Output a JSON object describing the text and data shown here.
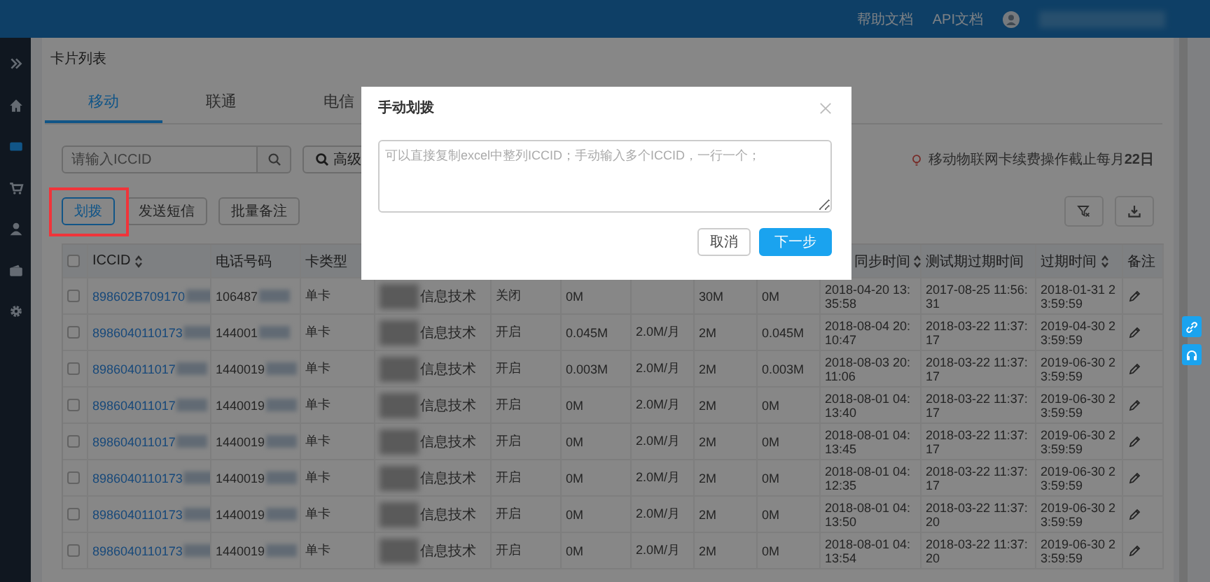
{
  "top_bar": {
    "links": [
      "帮助文档",
      "API文档"
    ]
  },
  "sidebar": {
    "items": [
      {
        "kind": "expand",
        "selected": false
      },
      {
        "kind": "home",
        "selected": false
      },
      {
        "kind": "card",
        "selected": true
      },
      {
        "kind": "cart",
        "selected": false
      },
      {
        "kind": "user",
        "selected": false
      },
      {
        "kind": "wallet",
        "selected": false
      },
      {
        "kind": "settings",
        "selected": false
      }
    ]
  },
  "page_title": "卡片列表",
  "tabs": [
    {
      "label": "移动",
      "selected": true
    },
    {
      "label": "联通",
      "selected": false
    },
    {
      "label": "电信",
      "selected": false
    }
  ],
  "search": {
    "placeholder": "请输入ICCID"
  },
  "advanced_button": "高级",
  "notice": "移动物联网卡续费操作截止每月**22日**",
  "actions": [
    {
      "label": "划拨",
      "active": true,
      "highlighted": true
    },
    {
      "label": "发送短信",
      "active": false,
      "highlighted": false
    },
    {
      "label": "批量备注",
      "active": false,
      "highlighted": false
    }
  ],
  "table": {
    "select_all": {
      "checked": false
    },
    "columns_left": [
      {
        "label": "ICCID",
        "sortable": true
      },
      {
        "label": "电话号码",
        "sortable": false
      },
      {
        "label": "卡类型",
        "sortable": false
      }
    ],
    "columns_right": [
      {
        "label": "同步时间",
        "sortable": true
      },
      {
        "label": "测试期过期时间",
        "sortable": false
      },
      {
        "label": "过期时间",
        "sortable": true
      },
      {
        "label": "备注",
        "sortable": false
      }
    ],
    "rows": [
      {
        "checked": false,
        "iccid": "898602B709170",
        "phone": "106487",
        "card_type": "单卡",
        "company": "信息技术",
        "status": "关闭",
        "used": "0M",
        "total": "30M",
        "remaining": "0M",
        "sync_time": "2018-04-20 13:35:58",
        "trial_expiry": "2017-08-25 11:56:31",
        "expiry": "2018-01-31 23:59:59"
      },
      {
        "checked": false,
        "iccid": "8986040110173",
        "phone": "144001",
        "card_type": "单卡",
        "company": "信息技术",
        "status": "开启",
        "used": "0.045M",
        "package": "2.0M/月",
        "total": "2M",
        "remaining": "0.045M",
        "sync_time": "2018-08-04 20:10:47",
        "trial_expiry": "2018-03-22 11:37:17",
        "expiry": "2019-04-30 23:59:59"
      },
      {
        "checked": false,
        "iccid": "898604011017",
        "phone": "1440019",
        "card_type": "单卡",
        "company": "信息技术",
        "status": "开启",
        "used": "0.003M",
        "package": "2.0M/月",
        "total": "2M",
        "remaining": "0.003M",
        "sync_time": "2018-08-03 20:11:06",
        "trial_expiry": "2018-03-22 11:37:17",
        "expiry": "2019-06-30 23:59:59"
      },
      {
        "checked": false,
        "iccid": "898604011017",
        "phone": "1440019",
        "card_type": "单卡",
        "company": "信息技术",
        "status": "开启",
        "used": "0M",
        "package": "2.0M/月",
        "total": "2M",
        "remaining": "0M",
        "sync_time": "2018-08-01 04:13:40",
        "trial_expiry": "2018-03-22 11:37:17",
        "expiry": "2019-06-30 23:59:59"
      },
      {
        "checked": false,
        "iccid": "898604011017",
        "phone": "1440019",
        "card_type": "单卡",
        "company": "信息技术",
        "status": "开启",
        "used": "0M",
        "package": "2.0M/月",
        "total": "2M",
        "remaining": "0M",
        "sync_time": "2018-08-01 04:13:45",
        "trial_expiry": "2018-03-22 11:37:17",
        "expiry": "2019-06-30 23:59:59"
      },
      {
        "checked": false,
        "iccid": "8986040110173",
        "phone": "1440019",
        "card_type": "单卡",
        "company": "信息技术",
        "status": "开启",
        "used": "0M",
        "package": "2.0M/月",
        "total": "2M",
        "remaining": "0M",
        "sync_time": "2018-08-01 04:12:35",
        "trial_expiry": "2018-03-22 11:37:17",
        "expiry": "2019-06-30 23:59:59"
      },
      {
        "checked": false,
        "iccid": "8986040110173",
        "phone": "1440019",
        "card_type": "单卡",
        "company": "信息技术",
        "status": "开启",
        "used": "0M",
        "package": "2.0M/月",
        "total": "2M",
        "remaining": "0M",
        "sync_time": "2018-08-01 04:13:50",
        "trial_expiry": "2018-03-22 11:37:20",
        "expiry": "2019-06-30 23:59:59"
      },
      {
        "checked": false,
        "iccid": "8986040110173",
        "phone": "1440019",
        "card_type": "单卡",
        "company": "信息技术",
        "status": "开启",
        "used": "0M",
        "package": "2.0M/月",
        "total": "2M",
        "remaining": "0M",
        "sync_time": "2018-08-01 04:13:54",
        "trial_expiry": "2018-03-22 11:37:20",
        "expiry": "2019-06-30 23:59:59"
      }
    ]
  },
  "dialog": {
    "title": "手动划拨",
    "placeholder": "可以直接复制excel中整列ICCID；手动输入多个ICCID，一行一个；",
    "buttons": [
      {
        "label": "取消",
        "kind": "default"
      },
      {
        "label": "下一步",
        "kind": "primary"
      }
    ]
  }
}
